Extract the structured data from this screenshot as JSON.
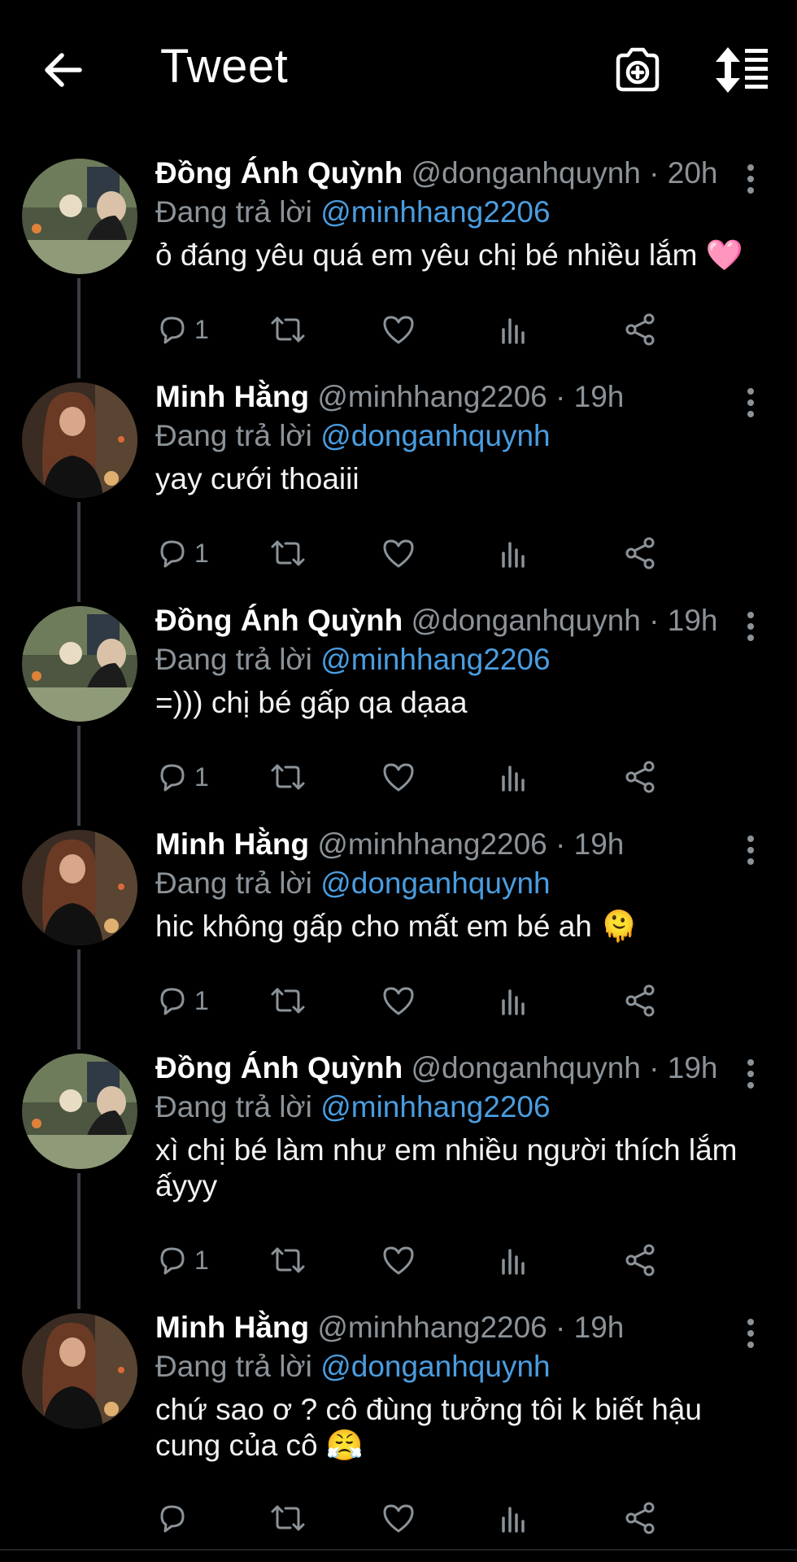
{
  "header": {
    "title": "Tweet",
    "back_icon": "arrow-left-icon",
    "camera_icon": "camera-plus-icon",
    "sort_icon": "sort-icon"
  },
  "colors": {
    "background": "#000000",
    "mention": "#4a9de0",
    "secondary_text": "#8b9399",
    "primary_text": "#ffffff"
  },
  "tweets": [
    {
      "name": "Đồng Ánh Quỳnh",
      "handle": "@donganhquynh",
      "time": "· 20h",
      "replying_label": "Đang trả lời",
      "replying_to": "@minhhang2206",
      "text": "ỏ đáng yêu quá em yêu chị bé nhiều lắm 🩷",
      "reply_count": "1"
    },
    {
      "name": "Minh Hằng",
      "handle": "@minhhang2206",
      "time": "· 19h",
      "replying_label": "Đang trả lời",
      "replying_to": "@donganhquynh",
      "text": "yay cưới thoaiii",
      "reply_count": "1"
    },
    {
      "name": "Đồng Ánh Quỳnh",
      "handle": "@donganhquynh",
      "time": "· 19h",
      "replying_label": "Đang trả lời",
      "replying_to": "@minhhang2206",
      "text": "=))) chị bé gấp qa dạaa",
      "reply_count": "1"
    },
    {
      "name": "Minh Hằng",
      "handle": "@minhhang2206",
      "time": "· 19h",
      "replying_label": "Đang trả lời",
      "replying_to": "@donganhquynh",
      "text": "hic không gấp cho mất em bé ah 🫠",
      "reply_count": "1"
    },
    {
      "name": "Đồng Ánh Quỳnh",
      "handle": "@donganhquynh",
      "time": "· 19h",
      "replying_label": "Đang trả lời",
      "replying_to": "@minhhang2206",
      "text": "xì chị bé làm như em nhiều người thích lắm ấyyy",
      "reply_count": "1"
    },
    {
      "name": "Minh Hằng",
      "handle": "@minhhang2206",
      "time": "· 19h",
      "replying_label": "Đang trả lời",
      "replying_to": "@donganhquynh",
      "text": "chứ sao ơ ? cô đùng tưởng tôi k biết hậu cung của cô 😤",
      "reply_count": ""
    }
  ]
}
